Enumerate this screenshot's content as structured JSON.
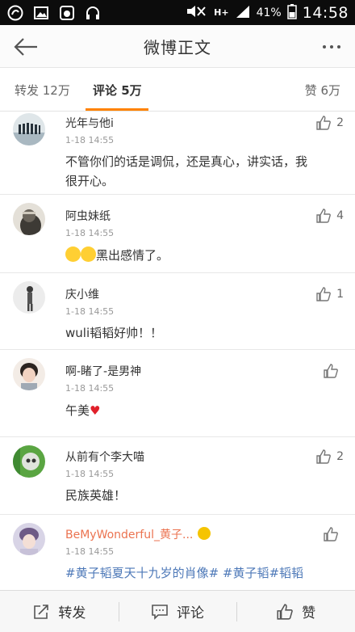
{
  "status_bar": {
    "battery": "41%",
    "time": "14:58",
    "network": "H+"
  },
  "header": {
    "title": "微博正文"
  },
  "tabs": {
    "repost": "转发 12万",
    "comment": "评论 5万",
    "like": "赞 6万"
  },
  "comments": [
    {
      "name": "光年与他i",
      "time": "1-18 14:55",
      "text": "不管你们的话是调侃，还是真心，讲实话，我很开心。",
      "likes": "2"
    },
    {
      "name": "阿虫妹纸",
      "time": "1-18 14:55",
      "text": "黑出感情了。",
      "likes": "4"
    },
    {
      "name": "庆小维",
      "time": "1-18 14:55",
      "text": "wuli韬韬好帅！！",
      "likes": "1"
    },
    {
      "name": "啊-睹了-是男神",
      "time": "1-18 14:55",
      "text": "午美",
      "likes": ""
    },
    {
      "name": "从前有个李大喵",
      "time": "1-18 14:55",
      "text": "民族英雄！",
      "likes": "2"
    },
    {
      "name": "BeMyWonderful_黄子...",
      "time": "1-18 14:55",
      "text": "#黄子韬夏天十九岁的肖像# #黄子韬#韬韬",
      "likes": ""
    }
  ],
  "bottom_bar": {
    "repost": "转发",
    "comment": "评论",
    "like": "赞"
  },
  "colors": {
    "accent": "#ff8200",
    "link": "#4e79b8",
    "vip_name": "#eb7350"
  }
}
